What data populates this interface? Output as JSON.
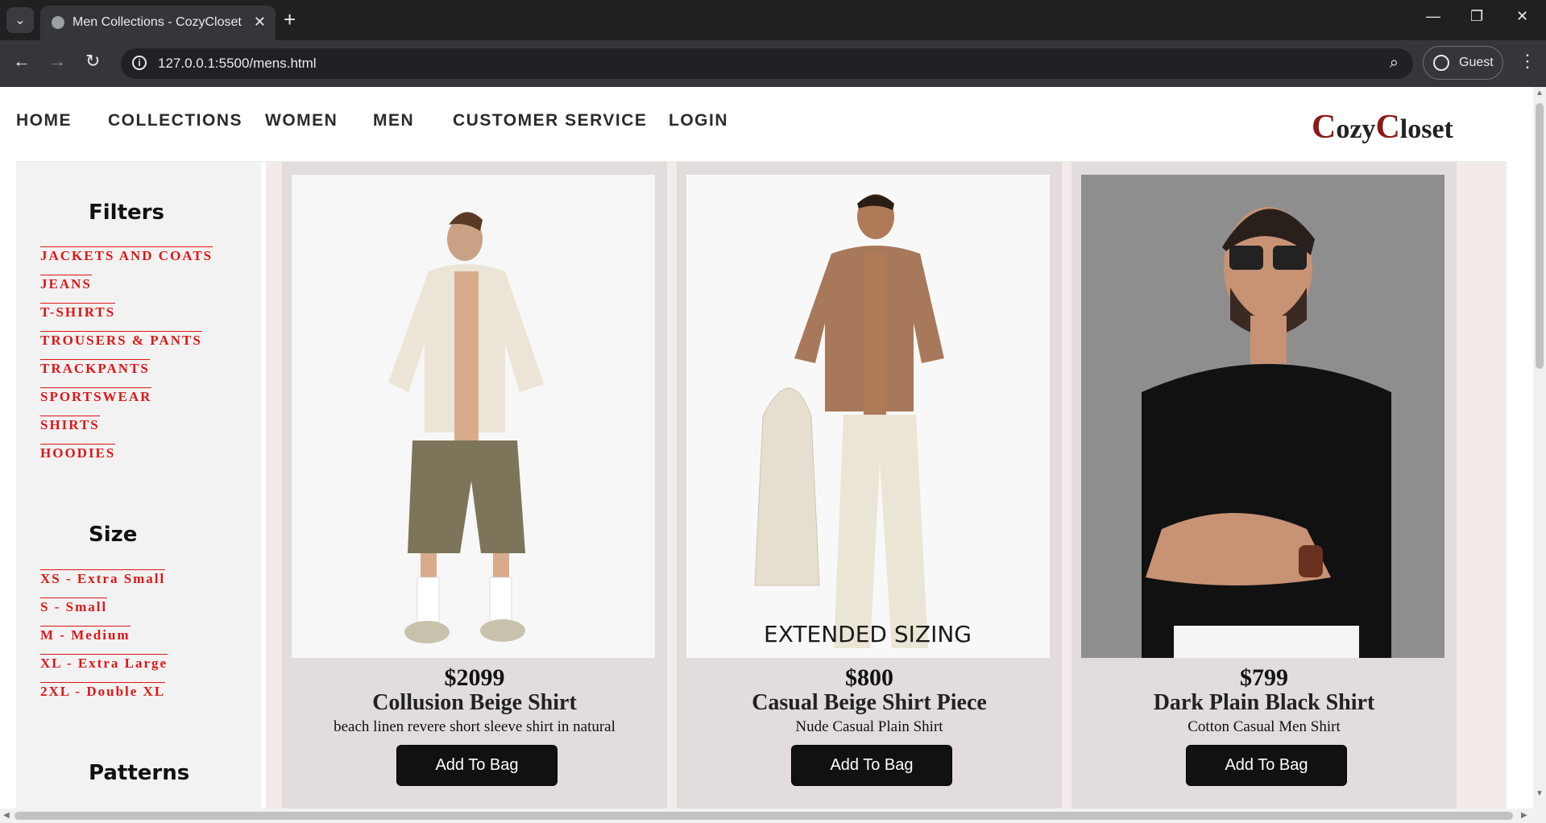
{
  "browser": {
    "tab_title": "Men Collections - CozyCloset",
    "url": "127.0.0.1:5500/mens.html",
    "profile_label": "Guest"
  },
  "site": {
    "nav": [
      "HOME",
      "COLLECTIONS",
      "WOMEN",
      "MEN",
      "CUSTOMER SERVICE",
      "LOGIN"
    ],
    "logo": {
      "c1": "C",
      "w1": "ozy",
      "c2": "C",
      "w2": "loset"
    }
  },
  "sidebar": {
    "filters_title": "Filters",
    "filters": [
      "JACKETS AND COATS",
      "JEANS",
      "T-SHIRTS",
      "TROUSERS & PANTS",
      "TRACKPANTS",
      "SPORTSWEAR",
      "SHIRTS",
      "HOODIES"
    ],
    "size_title": "Size",
    "sizes": [
      "XS - Extra Small",
      "S - Small",
      "M - Medium",
      "XL - Extra Large",
      "2XL - Double XL"
    ],
    "patterns_title": "Patterns"
  },
  "products": [
    {
      "price": "$2099",
      "name": "Collusion Beige Shirt",
      "desc": "beach linen revere short sleeve shirt in natural",
      "button": "Add To Bag"
    },
    {
      "price": "$800",
      "name": "Casual Beige Shirt Piece",
      "desc": "Nude Casual Plain Shirt",
      "button": "Add To Bag",
      "image_text": "EXTENDED SIZING"
    },
    {
      "price": "$799",
      "name": "Dark Plain Black Shirt",
      "desc": "Cotton Casual Men Shirt",
      "button": "Add To Bag"
    }
  ],
  "colors": {
    "accent_red": "#e01515",
    "logo_red": "#8b1a1a",
    "button_bg": "#111111",
    "card_bg": "#e2dcdc",
    "sidebar_bg": "#f2f2f2"
  }
}
